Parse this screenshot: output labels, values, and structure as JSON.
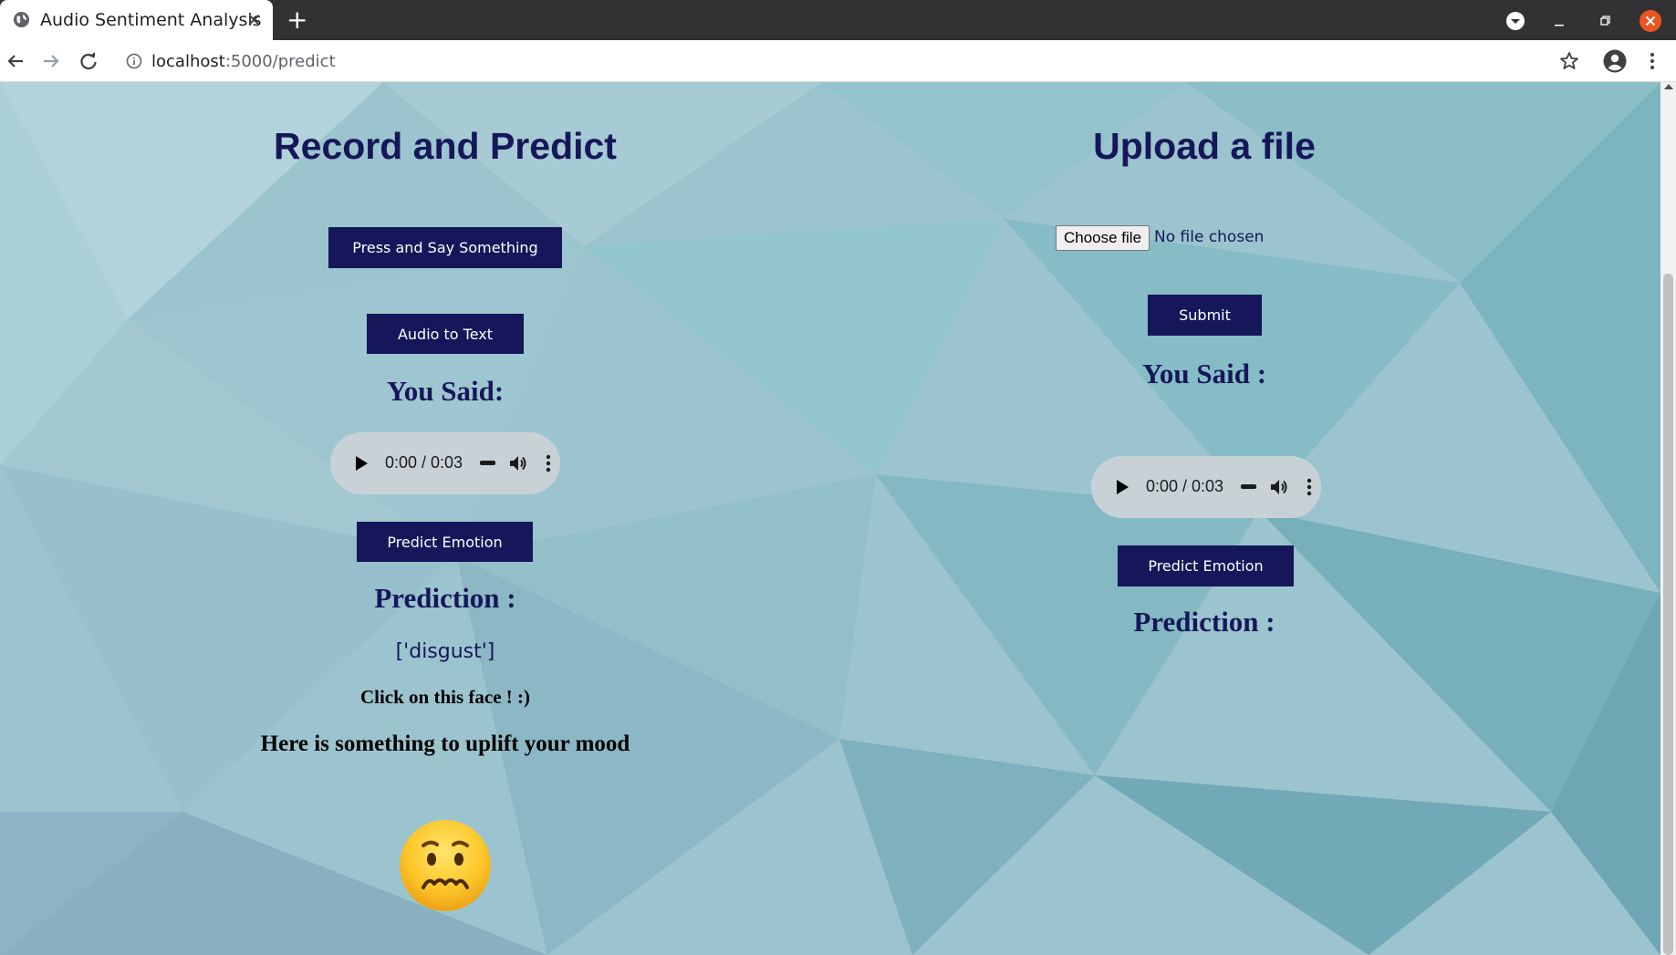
{
  "browser": {
    "tab_title": "Audio Sentiment Analysis",
    "tab_close": "✕",
    "new_tab": "+",
    "url_host": "localhost",
    "url_path": ":5000/predict"
  },
  "record": {
    "heading": "Record and Predict",
    "record_button": "Press and Say Something",
    "audio_to_text_button": "Audio to Text",
    "you_said": "You Said:",
    "audio_time": "0:00 / 0:03",
    "predict_button": "Predict Emotion",
    "prediction_label": "Prediction :",
    "prediction_value": "['disgust']",
    "face_prompt": "Click on this face ! :)",
    "uplift_text": "Here is something to uplift your mood",
    "face_icon": "nauseated-face-icon"
  },
  "upload": {
    "heading": "Upload a file",
    "choose_file_button": "Choose file",
    "no_file_text": "No file chosen",
    "submit_button": "Submit",
    "you_said": "You Said :",
    "audio_time": "0:00 / 0:03",
    "predict_button": "Predict Emotion",
    "prediction_label": "Prediction :"
  },
  "colors": {
    "accent": "#15175a",
    "background": "#9dc5cf"
  }
}
